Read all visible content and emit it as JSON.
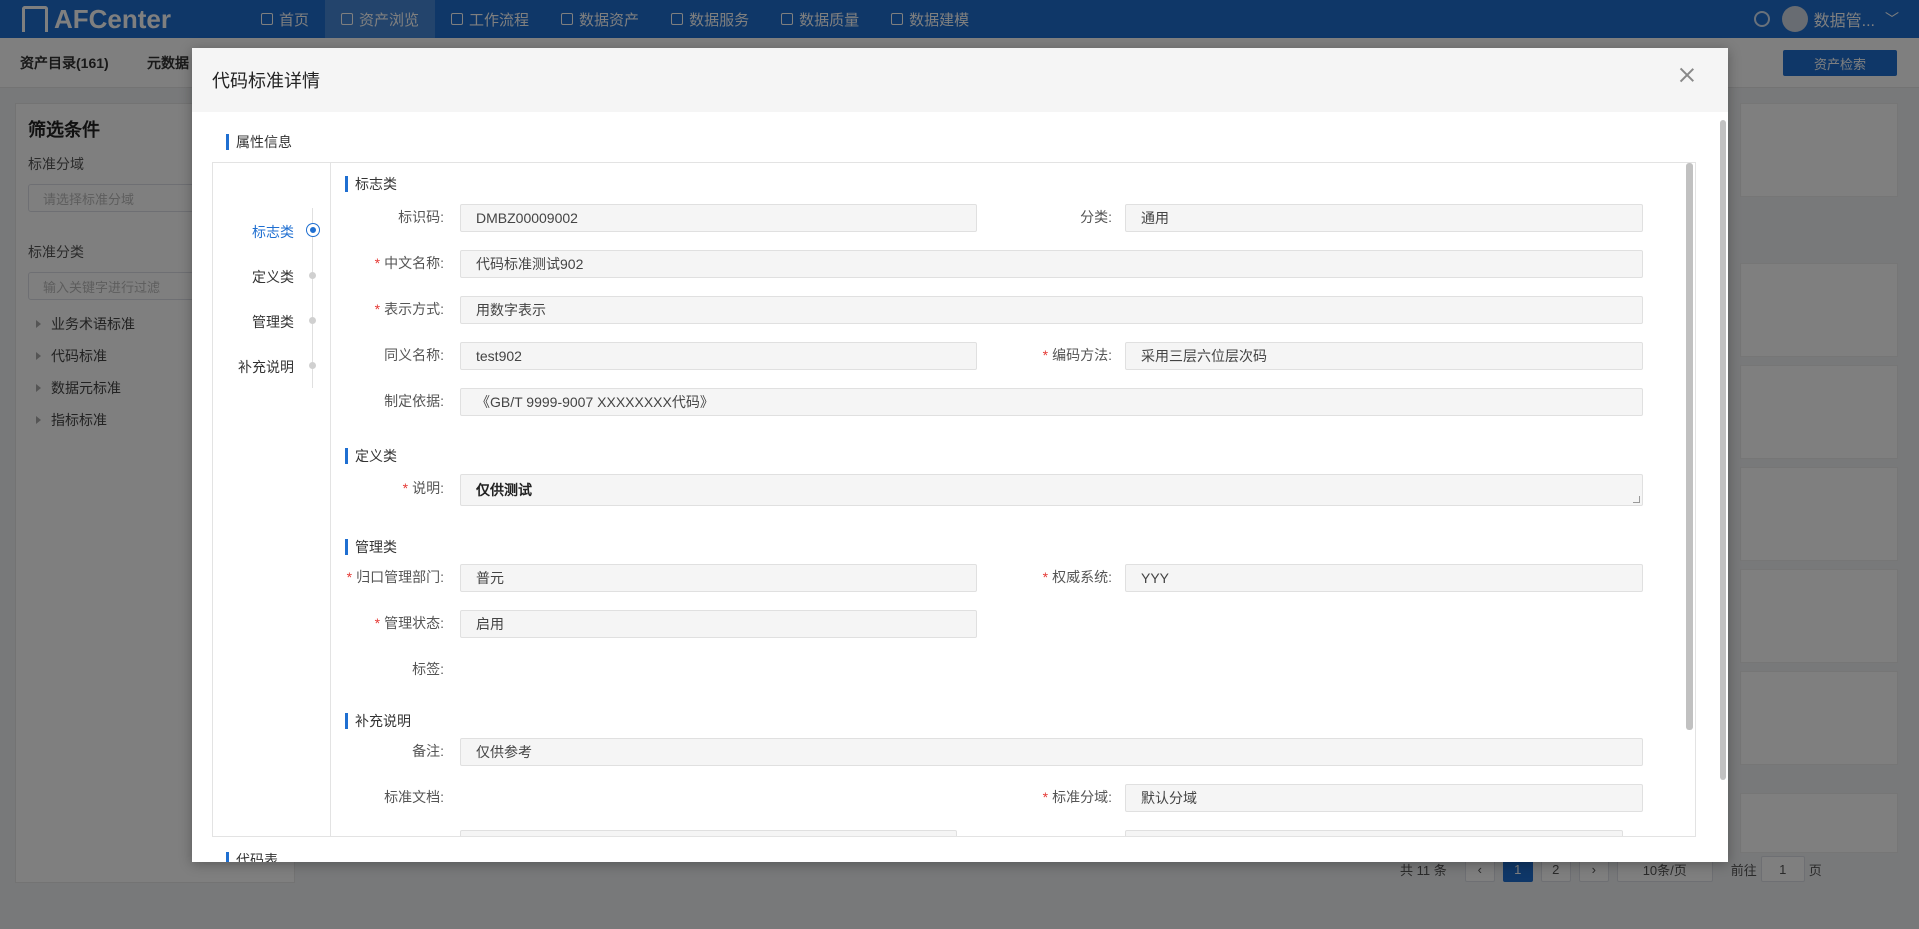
{
  "app": {
    "logo": "AFCenter",
    "nav": [
      {
        "label": "首页",
        "icon": "home-icon"
      },
      {
        "label": "资产浏览",
        "icon": "grid-icon"
      },
      {
        "label": "工作流程",
        "icon": "flow-icon"
      },
      {
        "label": "数据资产",
        "icon": "asset-icon"
      },
      {
        "label": "数据服务",
        "icon": "service-icon"
      },
      {
        "label": "数据质量",
        "icon": "quality-icon"
      },
      {
        "label": "数据建模",
        "icon": "layers-icon"
      }
    ],
    "user": "数据管..."
  },
  "subbar": {
    "tab_catalog": "资产目录(161)",
    "tab_meta": "元数据",
    "search_button": "资产检索"
  },
  "filter": {
    "title": "筛选条件",
    "domain_label": "标准分域",
    "domain_placeholder": "请选择标准分域",
    "category_label": "标准分类",
    "category_placeholder": "输入关键字进行过滤",
    "tree": [
      "业务术语标准",
      "代码标准",
      "数据元标准",
      "指标标准"
    ]
  },
  "pager": {
    "total": "共 11 条",
    "pages": [
      "1",
      "2"
    ],
    "page_size": "10条/页",
    "goto_prefix": "前往",
    "goto_value": "1",
    "goto_suffix": "页"
  },
  "modal": {
    "title": "代码标准详情",
    "section_attr": "属性信息",
    "section_code_table": "代码表",
    "anchors": [
      "标志类",
      "定义类",
      "管理类",
      "补充说明"
    ],
    "groups": {
      "ident": "标志类",
      "define": "定义类",
      "manage": "管理类",
      "extra": "补充说明"
    },
    "fields": {
      "id_code_label": "标识码:",
      "id_code": "DMBZ00009002",
      "category_label": "分类:",
      "category": "通用",
      "cn_name_label": "中文名称:",
      "cn_name": "代码标准测试902",
      "repr_label": "表示方式:",
      "repr": "用数字表示",
      "synonym_label": "同义名称:",
      "synonym": "test902",
      "encoding_label": "编码方法:",
      "encoding": "采用三层六位层次码",
      "basis_label": "制定依据:",
      "basis": "《GB/T 9999-9007 XXXXXXXX代码》",
      "desc_label": "说明:",
      "desc": "仅供测试",
      "dept_label": "归口管理部门:",
      "dept": "普元",
      "authority_label": "权威系统:",
      "authority": "YYY",
      "status_label": "管理状态:",
      "status": "启用",
      "tag_label": "标签:",
      "remark_label": "备注:",
      "remark": "仅供参考",
      "doc_label": "标准文档:",
      "domain_label": "标准分域:",
      "domain": "默认分域"
    }
  }
}
